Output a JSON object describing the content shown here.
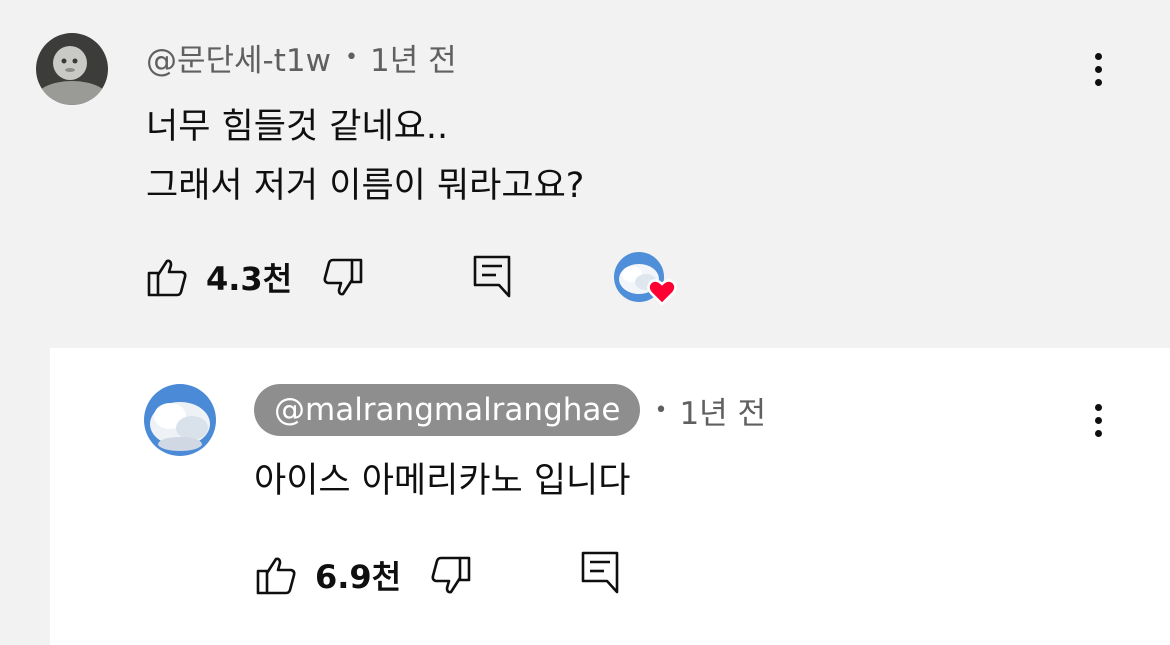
{
  "comment": {
    "handle": "@문단세-t1w",
    "separator": "•",
    "time": "1년 전",
    "lines": [
      "너무 힘들것 같네요..",
      "그래서 저거 이름이 뭐라고요?"
    ],
    "like_count": "4.3천",
    "heart_color": "#ff0033"
  },
  "reply": {
    "handle": "@malrangmalranghae",
    "separator": "•",
    "time": "1년 전",
    "text": "아이스 아메리카노 입니다",
    "like_count": "6.9천"
  },
  "icons": [
    "thumbs-up-icon",
    "thumbs-down-icon",
    "reply-icon",
    "more-vert-icon",
    "heart-icon"
  ],
  "colors": {
    "background_highlight": "#f2f2f2",
    "chip": "#8e8e8e",
    "meta_text": "#606060"
  }
}
